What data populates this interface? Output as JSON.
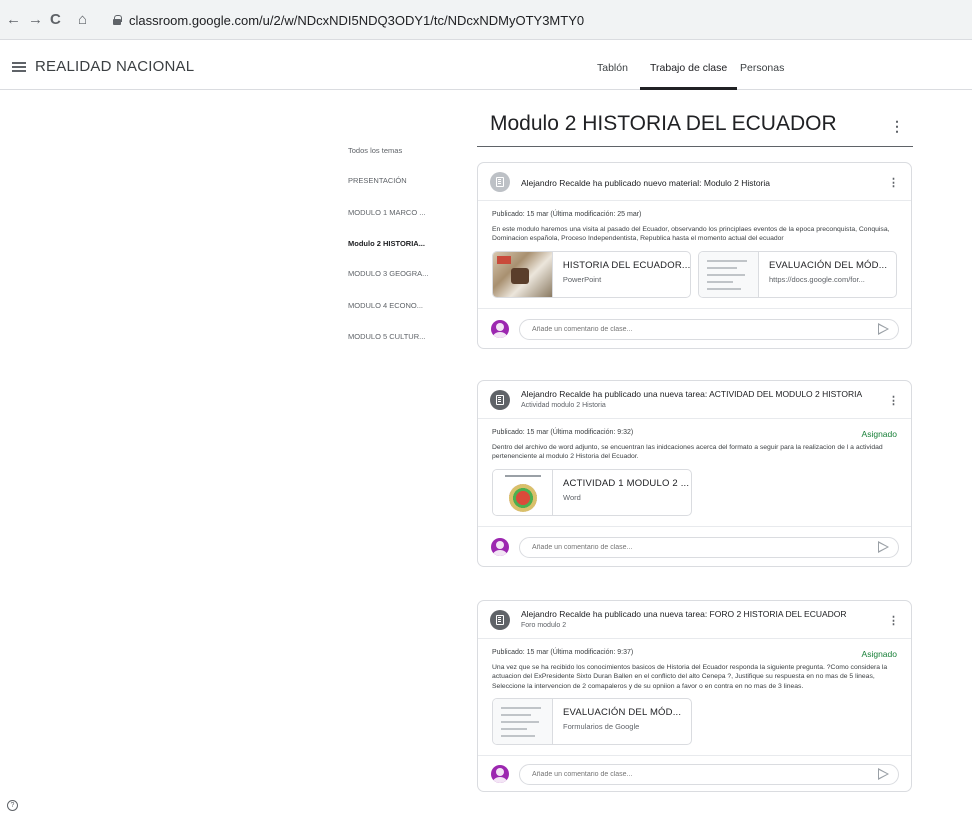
{
  "browser": {
    "back": "←",
    "forward": "→",
    "reload": "C",
    "home": "⌂",
    "url": "classroom.google.com/u/2/w/NDcxNDI5NDQ3ODY1/tc/NDcxNDMyOTY3MTY0"
  },
  "header": {
    "class_name": "REALIDAD NACIONAL",
    "tabs": [
      {
        "label": "Tablón",
        "active": false
      },
      {
        "label": "Trabajo de clase",
        "active": true
      },
      {
        "label": "Personas",
        "active": false
      }
    ]
  },
  "topics": {
    "all": "Todos los temas",
    "items": [
      {
        "label": "PRESENTACIÓN",
        "active": false
      },
      {
        "label": "MODULO 1 MARCO ...",
        "active": false
      },
      {
        "label": "Modulo 2 HISTORIA...",
        "active": true
      },
      {
        "label": "MODULO 3 GEOGRA...",
        "active": false
      },
      {
        "label": "MODULO 4 ECONO...",
        "active": false
      },
      {
        "label": "MODULO 5 CULTUR...",
        "active": false
      }
    ]
  },
  "section": {
    "title": "Modulo 2 HISTORIA DEL ECUADOR",
    "more": "⋮"
  },
  "posts": [
    {
      "icon": "material-icon",
      "title": "Alejandro Recalde ha publicado nuevo material: Modulo 2 Historia",
      "subtitle": "",
      "meta": "Publicado: 15 mar (Última modificación: 25 mar)",
      "status": "",
      "description": "En este modulo haremos una visita al pasado del Ecuador, observando los principlaes eventos de la epoca preconquista, Conquisa, Dominacion española, Proceso Independentista, Republica hasta el momento actual del ecuador",
      "attachments": [
        {
          "title": "HISTORIA DEL ECUADOR...",
          "subtitle": "PowerPoint",
          "thumb": "photo"
        },
        {
          "title": "EVALUACIÓN DEL MÓD...",
          "subtitle": "https://docs.google.com/for...",
          "thumb": "form"
        }
      ],
      "comment_placeholder": "Añade un comentario de clase..."
    },
    {
      "icon": "assignment-icon",
      "title": "Alejandro Recalde ha publicado una nueva tarea: ACTIVIDAD DEL MODULO 2 HISTORIA",
      "subtitle": "Actividad modulo 2 Historia",
      "meta": "Publicado: 15 mar (Última modificación: 9:32)",
      "status": "Asignado",
      "description": "Dentro del archivo de word  adjunto, se encuentran las inidcaciones acerca del formato a seguir  para la realizacion de l a actividad pertenenciente al modulo 2 Historia del Ecuador.",
      "attachments": [
        {
          "title": "ACTIVIDAD 1 MODULO 2 ...",
          "subtitle": "Word",
          "thumb": "word"
        }
      ],
      "comment_placeholder": "Añade un comentario de clase..."
    },
    {
      "icon": "assignment-icon",
      "title": "Alejandro Recalde ha publicado una nueva tarea: FORO 2 HISTORIA DEL ECUADOR",
      "subtitle": "Foro modulo 2",
      "meta": "Publicado: 15 mar (Última modificación: 9:37)",
      "status": "Asignado",
      "description": "Una vez que se ha recibido los conocimientos basicos de Historia del Ecuador responda la siguiente pregunta. ?Como considera la actuacion del ExPresidente Sixto Duran Ballen en el conflicto del alto Cenepa ?,  Justifique su respuesta en no mas de 5 lineas, Seleccione la intervencion de 2 comapaleros y de su opniion a favor o en contra en no mas de 3 lineas.",
      "attachments": [
        {
          "title": "EVALUACIÓN DEL MÓD...",
          "subtitle": "Formularios de Google",
          "thumb": "form"
        }
      ],
      "comment_placeholder": "Añade un comentario de clase..."
    }
  ],
  "help": "?"
}
